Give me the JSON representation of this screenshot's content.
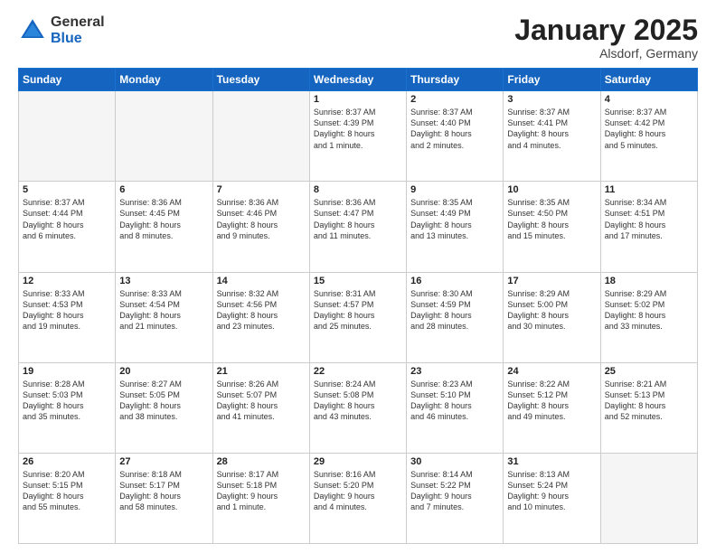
{
  "logo": {
    "general": "General",
    "blue": "Blue"
  },
  "header": {
    "month": "January 2025",
    "location": "Alsdorf, Germany"
  },
  "weekdays": [
    "Sunday",
    "Monday",
    "Tuesday",
    "Wednesday",
    "Thursday",
    "Friday",
    "Saturday"
  ],
  "weeks": [
    [
      {
        "day": "",
        "info": ""
      },
      {
        "day": "",
        "info": ""
      },
      {
        "day": "",
        "info": ""
      },
      {
        "day": "1",
        "info": "Sunrise: 8:37 AM\nSunset: 4:39 PM\nDaylight: 8 hours\nand 1 minute."
      },
      {
        "day": "2",
        "info": "Sunrise: 8:37 AM\nSunset: 4:40 PM\nDaylight: 8 hours\nand 2 minutes."
      },
      {
        "day": "3",
        "info": "Sunrise: 8:37 AM\nSunset: 4:41 PM\nDaylight: 8 hours\nand 4 minutes."
      },
      {
        "day": "4",
        "info": "Sunrise: 8:37 AM\nSunset: 4:42 PM\nDaylight: 8 hours\nand 5 minutes."
      }
    ],
    [
      {
        "day": "5",
        "info": "Sunrise: 8:37 AM\nSunset: 4:44 PM\nDaylight: 8 hours\nand 6 minutes."
      },
      {
        "day": "6",
        "info": "Sunrise: 8:36 AM\nSunset: 4:45 PM\nDaylight: 8 hours\nand 8 minutes."
      },
      {
        "day": "7",
        "info": "Sunrise: 8:36 AM\nSunset: 4:46 PM\nDaylight: 8 hours\nand 9 minutes."
      },
      {
        "day": "8",
        "info": "Sunrise: 8:36 AM\nSunset: 4:47 PM\nDaylight: 8 hours\nand 11 minutes."
      },
      {
        "day": "9",
        "info": "Sunrise: 8:35 AM\nSunset: 4:49 PM\nDaylight: 8 hours\nand 13 minutes."
      },
      {
        "day": "10",
        "info": "Sunrise: 8:35 AM\nSunset: 4:50 PM\nDaylight: 8 hours\nand 15 minutes."
      },
      {
        "day": "11",
        "info": "Sunrise: 8:34 AM\nSunset: 4:51 PM\nDaylight: 8 hours\nand 17 minutes."
      }
    ],
    [
      {
        "day": "12",
        "info": "Sunrise: 8:33 AM\nSunset: 4:53 PM\nDaylight: 8 hours\nand 19 minutes."
      },
      {
        "day": "13",
        "info": "Sunrise: 8:33 AM\nSunset: 4:54 PM\nDaylight: 8 hours\nand 21 minutes."
      },
      {
        "day": "14",
        "info": "Sunrise: 8:32 AM\nSunset: 4:56 PM\nDaylight: 8 hours\nand 23 minutes."
      },
      {
        "day": "15",
        "info": "Sunrise: 8:31 AM\nSunset: 4:57 PM\nDaylight: 8 hours\nand 25 minutes."
      },
      {
        "day": "16",
        "info": "Sunrise: 8:30 AM\nSunset: 4:59 PM\nDaylight: 8 hours\nand 28 minutes."
      },
      {
        "day": "17",
        "info": "Sunrise: 8:29 AM\nSunset: 5:00 PM\nDaylight: 8 hours\nand 30 minutes."
      },
      {
        "day": "18",
        "info": "Sunrise: 8:29 AM\nSunset: 5:02 PM\nDaylight: 8 hours\nand 33 minutes."
      }
    ],
    [
      {
        "day": "19",
        "info": "Sunrise: 8:28 AM\nSunset: 5:03 PM\nDaylight: 8 hours\nand 35 minutes."
      },
      {
        "day": "20",
        "info": "Sunrise: 8:27 AM\nSunset: 5:05 PM\nDaylight: 8 hours\nand 38 minutes."
      },
      {
        "day": "21",
        "info": "Sunrise: 8:26 AM\nSunset: 5:07 PM\nDaylight: 8 hours\nand 41 minutes."
      },
      {
        "day": "22",
        "info": "Sunrise: 8:24 AM\nSunset: 5:08 PM\nDaylight: 8 hours\nand 43 minutes."
      },
      {
        "day": "23",
        "info": "Sunrise: 8:23 AM\nSunset: 5:10 PM\nDaylight: 8 hours\nand 46 minutes."
      },
      {
        "day": "24",
        "info": "Sunrise: 8:22 AM\nSunset: 5:12 PM\nDaylight: 8 hours\nand 49 minutes."
      },
      {
        "day": "25",
        "info": "Sunrise: 8:21 AM\nSunset: 5:13 PM\nDaylight: 8 hours\nand 52 minutes."
      }
    ],
    [
      {
        "day": "26",
        "info": "Sunrise: 8:20 AM\nSunset: 5:15 PM\nDaylight: 8 hours\nand 55 minutes."
      },
      {
        "day": "27",
        "info": "Sunrise: 8:18 AM\nSunset: 5:17 PM\nDaylight: 8 hours\nand 58 minutes."
      },
      {
        "day": "28",
        "info": "Sunrise: 8:17 AM\nSunset: 5:18 PM\nDaylight: 9 hours\nand 1 minute."
      },
      {
        "day": "29",
        "info": "Sunrise: 8:16 AM\nSunset: 5:20 PM\nDaylight: 9 hours\nand 4 minutes."
      },
      {
        "day": "30",
        "info": "Sunrise: 8:14 AM\nSunset: 5:22 PM\nDaylight: 9 hours\nand 7 minutes."
      },
      {
        "day": "31",
        "info": "Sunrise: 8:13 AM\nSunset: 5:24 PM\nDaylight: 9 hours\nand 10 minutes."
      },
      {
        "day": "",
        "info": ""
      }
    ]
  ]
}
